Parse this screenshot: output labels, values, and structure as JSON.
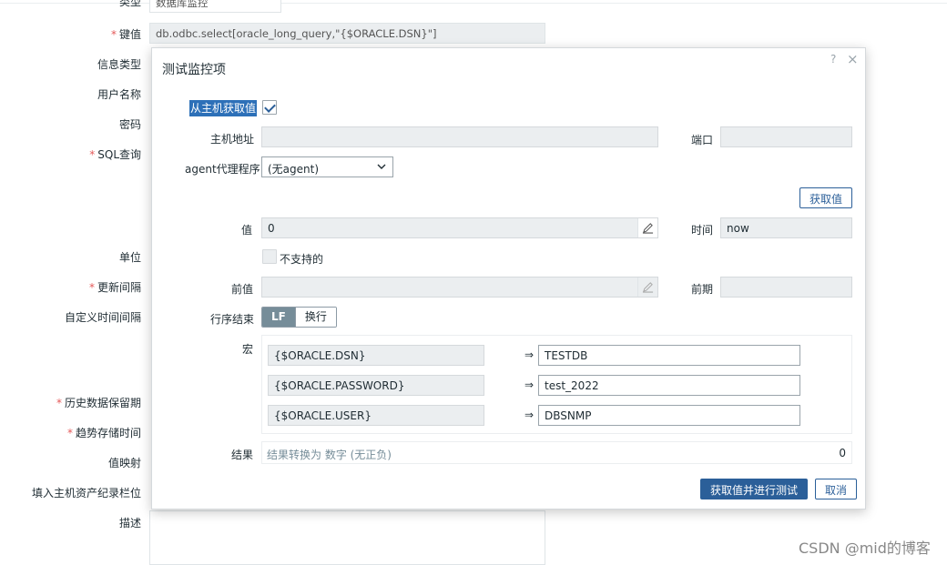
{
  "background_form": {
    "type_label": "类型",
    "type_value": "数据库监控",
    "key_label": "键值",
    "key_value": "db.odbc.select[oracle_long_query,\"{$ORACLE.DSN}\"]",
    "info_type_label": "信息类型",
    "username_label": "用户名称",
    "password_label": "密码",
    "sql_label": "SQL查询",
    "units_label": "单位",
    "update_interval_label": "更新间隔",
    "custom_interval_label": "自定义时间间隔",
    "history_label": "历史数据保留期",
    "trends_label": "趋势存储时间",
    "valuemap_label": "值映射",
    "inventory_label": "填入主机资产纪录栏位",
    "description_label": "描述"
  },
  "dialog": {
    "title": "测试监控项",
    "help": "?",
    "close": "×",
    "get_from_host_label": "从主机获取值",
    "get_from_host_checked": true,
    "host_address_label": "主机地址",
    "host_address_value": "",
    "port_label": "端口",
    "port_value": "",
    "proxy_label": "agent代理程序",
    "proxy_value": "(无agent)",
    "get_value_button": "获取值",
    "value_label": "值",
    "value_value": "0",
    "time_label": "时间",
    "time_value": "now",
    "not_supported_label": "不支持的",
    "prev_value_label": "前值",
    "prev_value_value": "",
    "prev_time_label": "前期",
    "prev_time_value": "",
    "eol_label": "行序结束",
    "eol_options": [
      "LF",
      "换行"
    ],
    "eol_selected": "LF",
    "macros_label": "宏",
    "macros": [
      {
        "name": "{$ORACLE.DSN}",
        "arrow": "⇒",
        "value": "TESTDB"
      },
      {
        "name": "{$ORACLE.PASSWORD}",
        "arrow": "⇒",
        "value": "test_2022"
      },
      {
        "name": "{$ORACLE.USER}",
        "arrow": "⇒",
        "value": "DBSNMP"
      }
    ],
    "result_label": "结果",
    "result_text": "结果转换为 数字 (无正负)",
    "result_value": "0",
    "test_button": "获取值并进行测试",
    "cancel_button": "取消"
  },
  "footer_watermark": "CSDN @mid的博客",
  "colors": {
    "accent": "#2b5f99",
    "required": "#e45959",
    "highlight": "#2d70b8",
    "segment_active": "#768d99"
  },
  "icons": [
    "checkmark-icon",
    "pencil-icon",
    "chevron-down-icon",
    "close-icon",
    "help-icon"
  ]
}
